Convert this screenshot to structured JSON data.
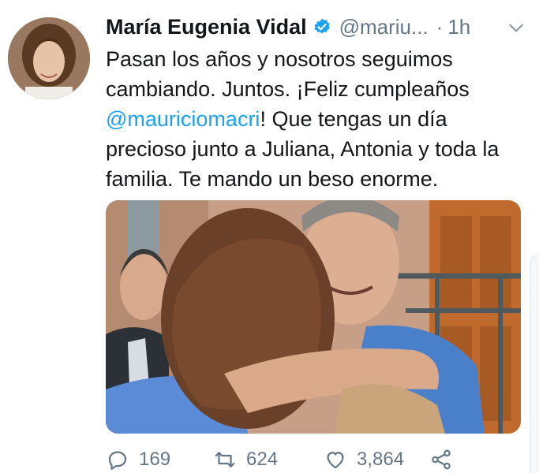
{
  "author": {
    "name": "María Eugenia Vidal",
    "handle": "@mariu...",
    "separator": "·",
    "time": "1h"
  },
  "tweet": {
    "text_before": "Pasan los años  y nosotros seguimos cambiando. Juntos. ¡Feliz cumpleaños ",
    "mention": "@mauriciomacri",
    "text_after": "! Que tengas un día precioso junto a Juliana, Antonia y toda la familia. Te mando un beso enorme."
  },
  "actions": {
    "replies": "169",
    "retweets": "624",
    "likes": "3,864"
  },
  "icons": {
    "verified": "verified-badge-icon",
    "menu": "chevron-down-icon",
    "reply": "reply-icon",
    "retweet": "retweet-icon",
    "like": "heart-icon",
    "share": "share-icon"
  },
  "colors": {
    "accent": "#1da1f2",
    "text": "#14171a",
    "muted": "#657786"
  }
}
